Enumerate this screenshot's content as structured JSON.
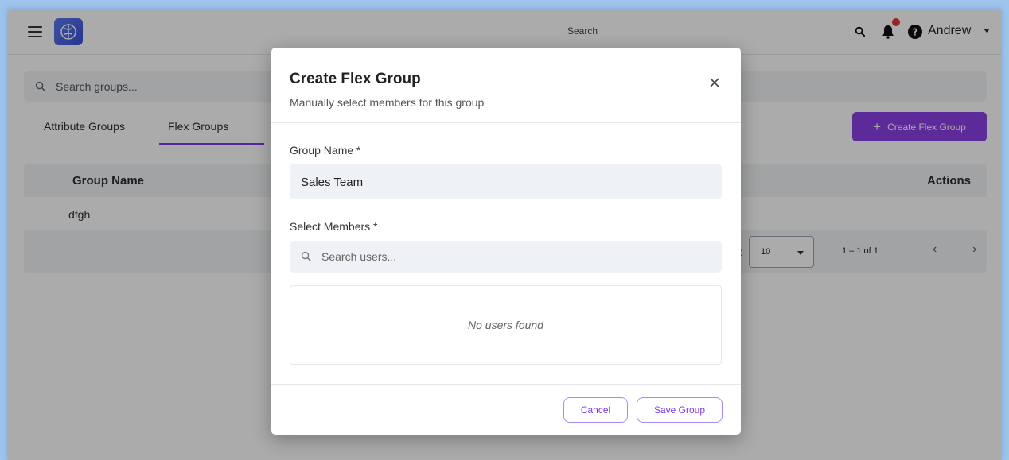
{
  "topbar": {
    "search_label": "Search",
    "user_name": "Andrew",
    "icons": [
      "menu-icon",
      "brain-logo-icon",
      "search-icon",
      "bell-icon",
      "help-icon",
      "caret-down-icon"
    ],
    "notification_dot_color": "#e53935"
  },
  "page": {
    "group_search_placeholder": "Search groups...",
    "tabs": [
      {
        "label": "Attribute Groups",
        "active": false
      },
      {
        "label": "Flex Groups",
        "active": true
      }
    ],
    "create_button_label": "Create Flex Group",
    "table": {
      "columns": [
        "Group Name",
        "Actions"
      ],
      "rows": [
        {
          "name": "dfgh"
        }
      ]
    },
    "pagination": {
      "per_page_value": "10",
      "range_label": "1 – 1 of 1"
    },
    "accent_color": "#8b3fe6"
  },
  "modal": {
    "title": "Create Flex Group",
    "subtitle": "Manually select members for this group",
    "group_name_label": "Group Name *",
    "group_name_value": "Sales Team",
    "members_label": "Select Members *",
    "users_search_placeholder": "Search users...",
    "empty_message": "No users found",
    "cancel_label": "Cancel",
    "save_label": "Save Group"
  }
}
